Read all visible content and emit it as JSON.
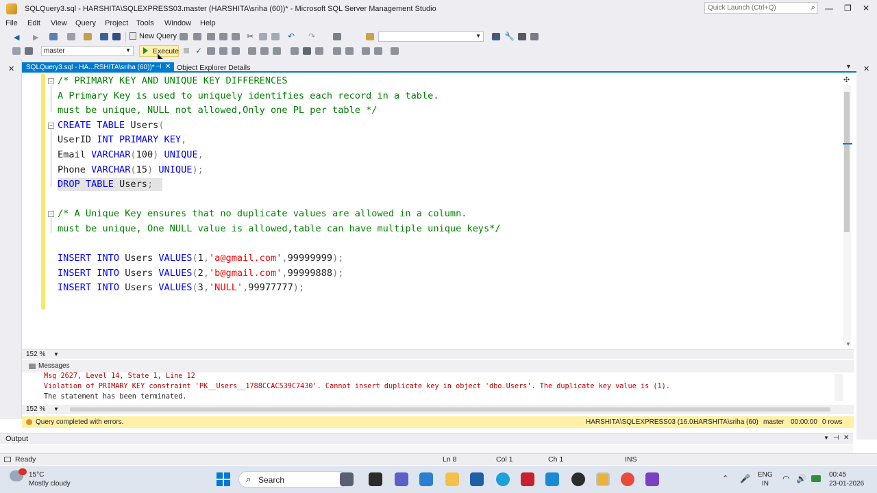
{
  "window": {
    "title": "SQLQuery3.sql - HARSHITA\\SQLEXPRESS03.master (HARSHITA\\sriha (60))* - Microsoft SQL Server Management Studio",
    "quick_launch_placeholder": "Quick Launch (Ctrl+Q)"
  },
  "menu": [
    "File",
    "Edit",
    "View",
    "Query",
    "Project",
    "Tools",
    "Window",
    "Help"
  ],
  "toolbar": {
    "new_query_label": "New Query",
    "database": "master",
    "execute_label": "Execute"
  },
  "tabs": {
    "active": "SQLQuery3.sql - HA...RSHITA\\sriha (60))*",
    "other": "Object Explorer Details"
  },
  "editor": {
    "lines": [
      {
        "parts": [
          [
            "cm",
            "/* PRIMARY KEY AND UNIQUE KEY DIFFERENCES"
          ]
        ]
      },
      {
        "parts": [
          [
            "cm",
            "A Primary Key is used to uniquely identifies each record in a table."
          ]
        ]
      },
      {
        "parts": [
          [
            "cm",
            "must be unique, NULL not allowed,Only one PL per table */"
          ]
        ]
      },
      {
        "parts": [
          [
            "kw",
            "CREATE TABLE "
          ],
          [
            "fn",
            "Users"
          ],
          [
            "gy",
            "("
          ]
        ]
      },
      {
        "parts": [
          [
            "fn",
            "UserID "
          ],
          [
            "kw",
            "INT PRIMARY KEY"
          ],
          [
            "gy",
            ","
          ]
        ]
      },
      {
        "parts": [
          [
            "fn",
            "Email "
          ],
          [
            "kw",
            "VARCHAR"
          ],
          [
            "gy",
            "("
          ],
          [
            "fn",
            "100"
          ],
          [
            "gy",
            ") "
          ],
          [
            "kw",
            "UNIQUE"
          ],
          [
            "gy",
            ","
          ]
        ]
      },
      {
        "parts": [
          [
            "fn",
            "Phone "
          ],
          [
            "kw",
            "VARCHAR"
          ],
          [
            "gy",
            "("
          ],
          [
            "fn",
            "15"
          ],
          [
            "gy",
            ") "
          ],
          [
            "kw",
            "UNIQUE"
          ],
          [
            "gy",
            ");"
          ]
        ]
      },
      {
        "parts": [
          [
            "kw",
            "DROP TABLE "
          ],
          [
            "fn",
            "Users"
          ],
          [
            "gy",
            ";"
          ]
        ]
      },
      {
        "parts": [
          [
            "fn",
            ""
          ]
        ]
      },
      {
        "parts": [
          [
            "cm",
            "/* A Unique Key ensures that no duplicate values are allowed in a column."
          ]
        ]
      },
      {
        "parts": [
          [
            "cm",
            "must be unique, One NULL value is allowed,table can have multiple unique keys*/"
          ]
        ]
      },
      {
        "parts": [
          [
            "fn",
            ""
          ]
        ]
      },
      {
        "parts": [
          [
            "kw",
            "INSERT INTO "
          ],
          [
            "fn",
            "Users "
          ],
          [
            "kw",
            "VALUES"
          ],
          [
            "gy",
            "("
          ],
          [
            "fn",
            "1"
          ],
          [
            "gy",
            ","
          ],
          [
            "st",
            "'a@gmail.com'"
          ],
          [
            "gy",
            ","
          ],
          [
            "fn",
            "99999999"
          ],
          [
            "gy",
            ");"
          ]
        ]
      },
      {
        "parts": [
          [
            "kw",
            "INSERT INTO "
          ],
          [
            "fn",
            "Users "
          ],
          [
            "kw",
            "VALUES"
          ],
          [
            "gy",
            "("
          ],
          [
            "fn",
            "2"
          ],
          [
            "gy",
            ","
          ],
          [
            "st",
            "'b@gmail.com'"
          ],
          [
            "gy",
            ","
          ],
          [
            "fn",
            "99999888"
          ],
          [
            "gy",
            ");"
          ]
        ]
      },
      {
        "parts": [
          [
            "kw",
            "INSERT INTO "
          ],
          [
            "fn",
            "Users "
          ],
          [
            "kw",
            "VALUES"
          ],
          [
            "gy",
            "("
          ],
          [
            "fn",
            "3"
          ],
          [
            "gy",
            ","
          ],
          [
            "st",
            "'NULL'"
          ],
          [
            "gy",
            ","
          ],
          [
            "fn",
            "99977777"
          ],
          [
            "gy",
            ");"
          ]
        ]
      }
    ],
    "zoom": "152 %"
  },
  "messages": {
    "tab_label": "Messages",
    "lines": [
      "Msg 2627, Level 14, State 1, Line 12",
      "Violation of PRIMARY KEY constraint 'PK__Users__1788CCAC539C7430'. Cannot insert duplicate key in object 'dbo.Users'. The duplicate key value is (1).",
      "The statement has been terminated."
    ],
    "zoom": "152 %"
  },
  "query_status": {
    "text": "Query completed with errors.",
    "server": "HARSHITA\\SQLEXPRESS03 (16.0...",
    "user": "HARSHITA\\sriha (60)",
    "database": "master",
    "elapsed": "00:00:00",
    "rows": "0 rows"
  },
  "output_label": "Output",
  "statusbar": {
    "ready": "Ready",
    "ln": "Ln 8",
    "col": "Col 1",
    "ch": "Ch 1",
    "ins": "INS"
  },
  "taskbar": {
    "weather_temp": "15°C",
    "weather_desc": "Mostly cloudy",
    "search_label": "Search",
    "lang_1": "ENG",
    "lang_2": "IN",
    "time": "00:45",
    "date": "23-01-2026"
  },
  "colors": {
    "accent": "#007acc",
    "execute_bg": "#fff1a8",
    "status_bg": "#fff0a8",
    "keyword": "#0000ff",
    "comment": "#008000",
    "string": "#ff0000"
  }
}
